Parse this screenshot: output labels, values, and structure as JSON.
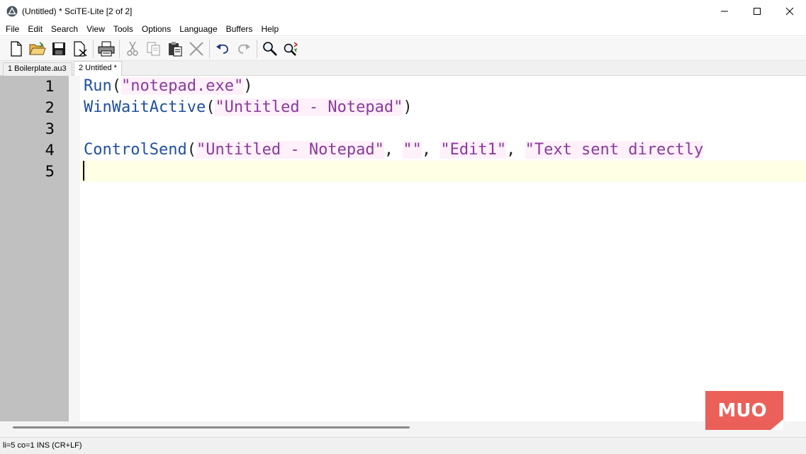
{
  "window": {
    "title": "(Untitled) * SciTE-Lite [2 of 2]",
    "minimize": "minimize",
    "maximize": "maximize",
    "close": "close"
  },
  "menu": {
    "items": [
      "File",
      "Edit",
      "Search",
      "View",
      "Tools",
      "Options",
      "Language",
      "Buffers",
      "Help"
    ]
  },
  "toolbar": {
    "icons": [
      "new-file-icon",
      "open-folder-icon",
      "save-icon",
      "close-file-icon",
      "print-icon",
      "cut-icon",
      "copy-icon",
      "paste-icon",
      "delete-icon",
      "undo-icon",
      "redo-icon",
      "find-icon",
      "replace-icon"
    ]
  },
  "tabs": [
    {
      "label": "1 Boilerplate.au3",
      "active": false
    },
    {
      "label": "2 Untitled *",
      "active": true
    }
  ],
  "editor": {
    "line_numbers": [
      "1",
      "2",
      "3",
      "4",
      "5"
    ],
    "lines": [
      {
        "func": "Run",
        "open": "(",
        "args": [
          {
            "str": "\"notepad.exe\""
          }
        ],
        "close": ")"
      },
      {
        "func": "WinWaitActive",
        "open": "(",
        "args": [
          {
            "str": "\"Untitled - Notepad\""
          }
        ],
        "close": ")"
      },
      {
        "func": "",
        "open": "",
        "args": [],
        "close": ""
      },
      {
        "func": "ControlSend",
        "open": "(",
        "args": [
          {
            "str": "\"Untitled - Notepad\""
          },
          {
            "sep": ", "
          },
          {
            "str": "\"\""
          },
          {
            "sep": ", "
          },
          {
            "str": "\"Edit1\""
          },
          {
            "sep": ", "
          },
          {
            "str": "\"Text sent directly"
          }
        ],
        "close": ""
      },
      {
        "func": "",
        "open": "",
        "args": [],
        "close": ""
      }
    ],
    "current_line": 5
  },
  "status": {
    "text": "li=5 co=1 INS (CR+LF)"
  },
  "watermark": {
    "text": "MUO",
    "color": "#e8453c"
  },
  "colors": {
    "function": "#1f4fa0",
    "string": "#8a3a9c",
    "gutter": "#c0c0c0",
    "caret_line": "#ffffe6"
  }
}
